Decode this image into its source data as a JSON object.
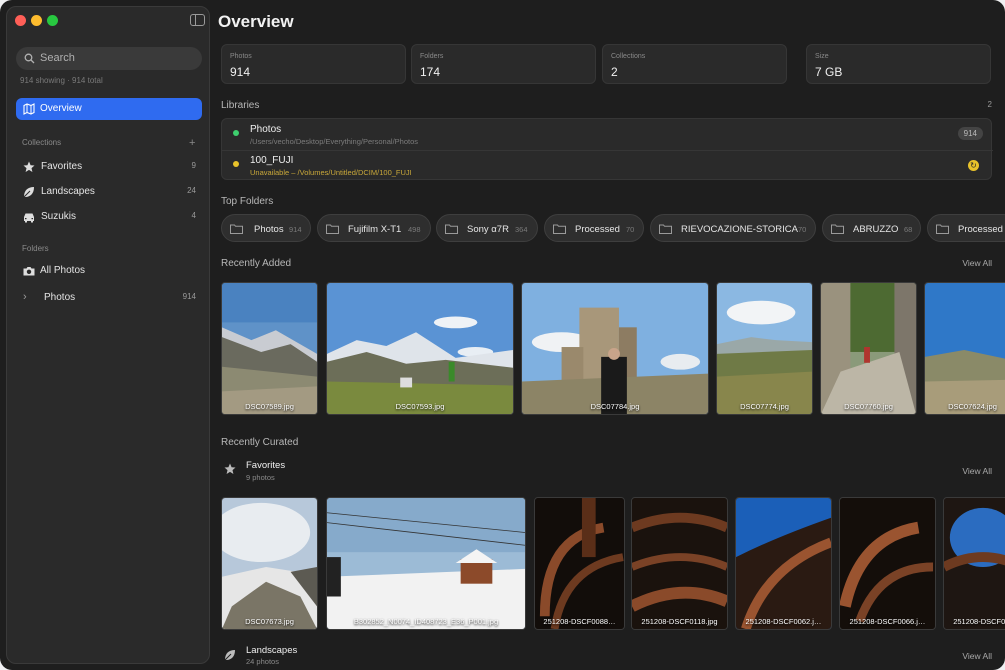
{
  "window": {
    "title": "Overview"
  },
  "sidebar": {
    "search_placeholder": "Search",
    "showing": "914 showing",
    "total": "914 total",
    "active": "Overview",
    "collections_header": "Collections",
    "add_label": "+",
    "collections": [
      {
        "label": "Favorites",
        "count": "9"
      },
      {
        "label": "Landscapes",
        "count": "24"
      },
      {
        "label": "Suzukis",
        "count": "4"
      }
    ],
    "folders_header": "Folders",
    "all_photos": "All Photos",
    "photos_folder": {
      "label": "Photos",
      "count": "914",
      "chevron": "›"
    }
  },
  "stats": [
    {
      "label": "Photos",
      "value": "914"
    },
    {
      "label": "Folders",
      "value": "174"
    },
    {
      "label": "Collections",
      "value": "2"
    },
    {
      "label": "Size",
      "value": "7 GB"
    }
  ],
  "libraries": {
    "header": "Libraries",
    "count": "2",
    "items": [
      {
        "name": "Photos",
        "path": "/Users/vecho/Desktop/Everything/Personal/Photos",
        "badge": "914",
        "color": "#3ecf6e"
      },
      {
        "name": "100_FUJI",
        "path": "Unavailable – /Volumes/Untitled/DCIM/100_FUJI",
        "color": "#e8c22a",
        "path_color": "#c9a83a"
      }
    ]
  },
  "top_folders": {
    "header": "Top Folders",
    "items": [
      {
        "name": "Photos",
        "count": "914"
      },
      {
        "name": "Fujifilm X-T1",
        "count": "498"
      },
      {
        "name": "Sony α7R",
        "count": "364"
      },
      {
        "name": "Processed",
        "count": "70"
      },
      {
        "name": "RIEVOCAZIONE-STORICA",
        "count": "70"
      },
      {
        "name": "ABRUZZO",
        "count": "68"
      },
      {
        "name": "Processed",
        "count": ""
      }
    ]
  },
  "recently_added": {
    "header": "Recently Added",
    "view_all": "View All",
    "photos": [
      "DSC07589.jpg",
      "DSC07593.jpg",
      "DSC07784.jpg",
      "DSC07774.jpg",
      "DSC07760.jpg",
      "DSC07624.jpg"
    ]
  },
  "recently_curated": {
    "header": "Recently Curated",
    "favorites": {
      "title": "Favorites",
      "subtitle": "9 photos",
      "view_all": "View All",
      "photos": [
        "DSC07673.jpg",
        "B302852_N0074_ID408723_E36_P001.jpg",
        "251208-DSCF0088…",
        "251208-DSCF0118.jpg",
        "251208-DSCF0062.j…",
        "251208-DSCF0066.j…",
        "251208-DSCF0…"
      ]
    },
    "landscapes": {
      "title": "Landscapes",
      "subtitle": "24 photos",
      "view_all": "View All"
    }
  },
  "colors": {
    "accent": "#2f6bf0",
    "sidebar_bg": "#2a2a2a",
    "main_bg": "#1e1e1e"
  }
}
